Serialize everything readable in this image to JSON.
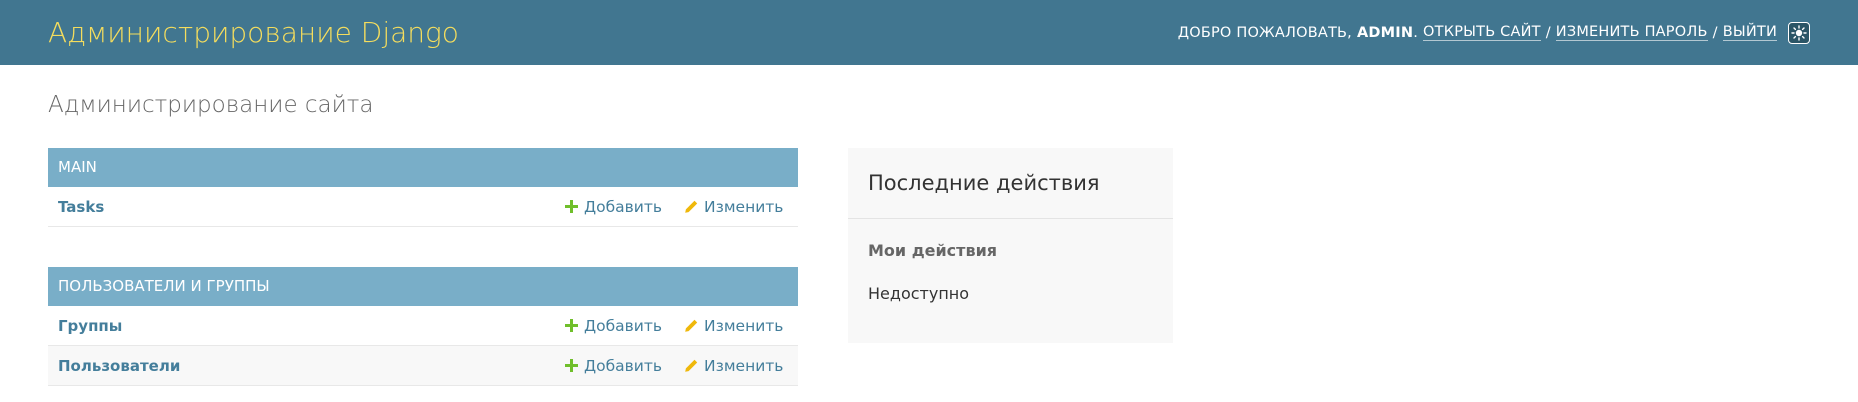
{
  "header": {
    "branding": "Администрирование Django",
    "welcome": "Добро пожаловать,",
    "username": "admin",
    "view_site": "Открыть сайт",
    "change_password": "Изменить пароль",
    "logout": "Выйти",
    "separator": "/",
    "theme_toggle_icon": "theme-toggle-icon"
  },
  "page": {
    "title": "Администрирование сайта"
  },
  "apps": [
    {
      "caption": "Main",
      "models": [
        {
          "name": "Tasks",
          "add": "Добавить",
          "change": "Изменить"
        }
      ]
    },
    {
      "caption": "Пользователи и группы",
      "models": [
        {
          "name": "Группы",
          "add": "Добавить",
          "change": "Изменить"
        },
        {
          "name": "Пользователи",
          "add": "Добавить",
          "change": "Изменить"
        }
      ]
    }
  ],
  "recent_actions": {
    "title": "Последние действия",
    "subtitle": "Мои действия",
    "empty": "Недоступно"
  },
  "colors": {
    "header_bg": "#417690",
    "brand": "#f5dd5d",
    "caption_bg": "#79aec8",
    "link": "#447e9b",
    "add_icon": "#70bf2b",
    "change_icon": "#efb80b"
  }
}
